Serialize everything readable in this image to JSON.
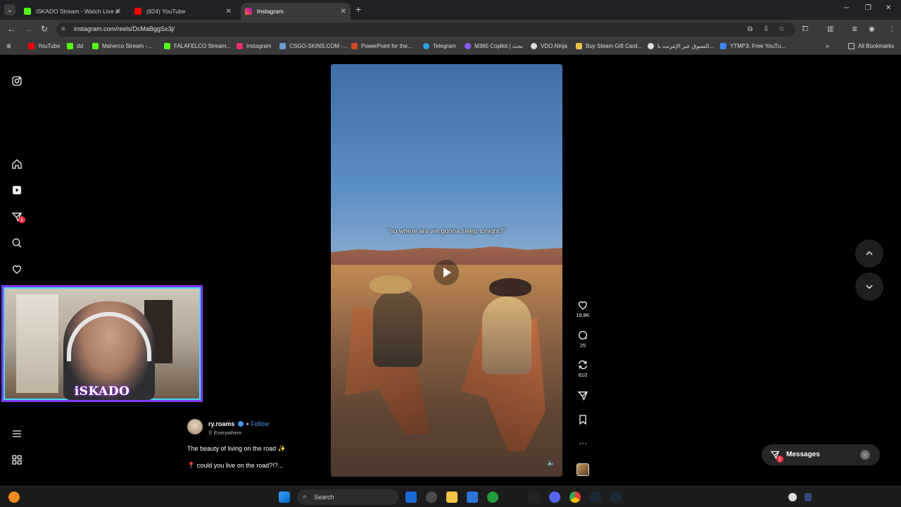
{
  "browser": {
    "tabs": [
      {
        "title": "iSKADO Stream - Watch Live o",
        "favicon_color": "#53fc18",
        "active": false
      },
      {
        "title": "(824) YouTube",
        "favicon_color": "#ff0000",
        "active": false
      },
      {
        "title": "Instagram",
        "favicon_color": "#e1306c",
        "active": true
      }
    ],
    "address": "instagram.com/reels/DcMaBggSx3j/",
    "bookmarks": [
      {
        "label": "YouTube",
        "color": "#ff0000"
      },
      {
        "label": "dd",
        "color": "#53fc18"
      },
      {
        "label": "Maherco Stream -...",
        "color": "#53fc18"
      },
      {
        "label": "FALAFELCO Stream...",
        "color": "#53fc18"
      },
      {
        "label": "Instagram",
        "color": "#e1306c"
      },
      {
        "label": "CSGO-SKINS.COM -...",
        "color": "#6a9ccf"
      },
      {
        "label": "PowerPoint for the...",
        "color": "#d24726"
      },
      {
        "label": "Telegram",
        "color": "#2aa5e0"
      },
      {
        "label": "M365 Copilot | بحث",
        "color": "#8b5cf6"
      },
      {
        "label": "VDO.Ninja",
        "color": "#dddddd"
      },
      {
        "label": "Buy Steam Gift Card...",
        "color": "#e6c14a"
      },
      {
        "label": "التسوق عبر الإنترنت با...",
        "color": "#dddddd"
      },
      {
        "label": "YTMP3: Free YouTu...",
        "color": "#3b82f6"
      }
    ],
    "all_bookmarks": "All Bookmarks"
  },
  "stream_overlay": {
    "name": "iSKADO"
  },
  "sidebar": {
    "badge_count": "1"
  },
  "reel": {
    "caption": "\"so where are we gonna sleep tonight?\"",
    "likes": "19.8K",
    "comments": "25",
    "reposts": "610",
    "author": {
      "username": "ry.roams",
      "separator": "•",
      "follow": "Follow",
      "location": "Everywhere"
    },
    "description_line1": "The beauty of living on the road ✨",
    "description_line2": "could you live on the road?!?..."
  },
  "messages": {
    "label": "Messages",
    "badge": "1"
  },
  "taskbar": {
    "search_placeholder": "Search"
  }
}
